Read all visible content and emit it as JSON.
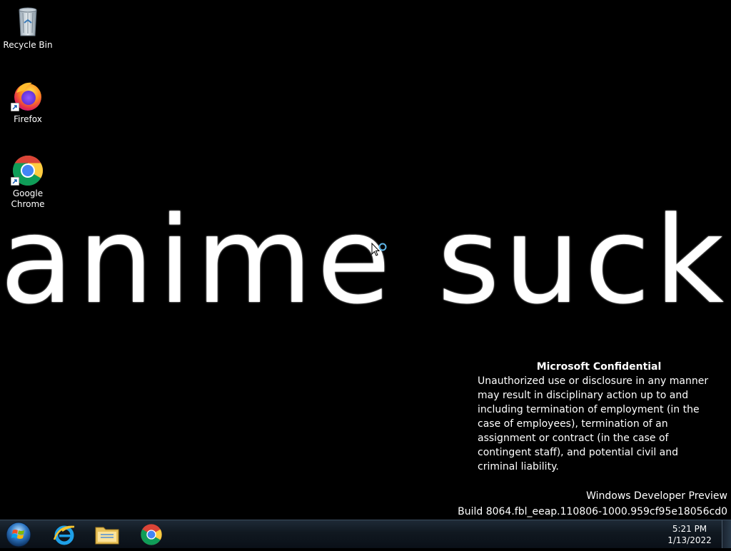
{
  "desktop": {
    "icons": [
      {
        "label": "Recycle Bin",
        "icon": "recycle-bin-icon"
      },
      {
        "label": "Firefox",
        "icon": "firefox-icon"
      },
      {
        "label": "Google\nChrome",
        "icon": "chrome-icon"
      }
    ],
    "wallpaper_text": "anime sucks",
    "confidential": {
      "title": "Microsoft Confidential",
      "body": "Unauthorized use or disclosure in any manner may result in disciplinary action up to and including termination of employment (in the case of employees), termination of an assignment or contract (in the case of contingent staff), and potential civil and criminal liability."
    },
    "build": {
      "edition": "Windows Developer Preview",
      "number": "Build 8064.fbl_eeap.110806-1000.959cf95e18056cd0"
    }
  },
  "taskbar": {
    "start": "windows-start-orb-icon",
    "pinned": [
      {
        "name": "internet-explorer",
        "icon": "internet-explorer-icon"
      },
      {
        "name": "file-explorer",
        "icon": "folder-icon"
      },
      {
        "name": "google-chrome",
        "icon": "chrome-icon"
      }
    ],
    "clock": {
      "time": "5:21 PM",
      "date": "1/13/2022"
    }
  },
  "colors": {
    "desktop_bg": "#000000",
    "text": "#ffffff",
    "taskbar_bg": "#101820"
  }
}
